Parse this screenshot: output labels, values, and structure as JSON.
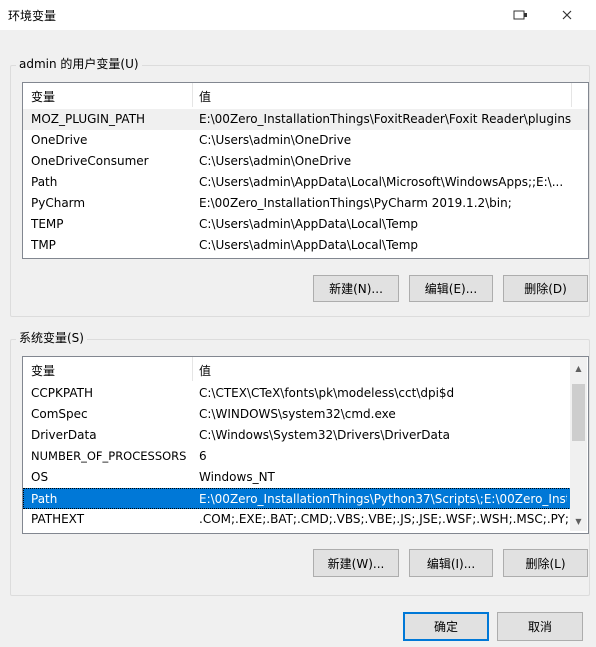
{
  "window": {
    "title": "环境变量",
    "icons": [
      "restore-icon",
      "close-icon"
    ]
  },
  "user_group": {
    "label": "admin 的用户变量(U)",
    "columns": {
      "name": "变量",
      "value": "值"
    },
    "rows": [
      {
        "name": "MOZ_PLUGIN_PATH",
        "value": "E:\\00Zero_InstallationThings\\FoxitReader\\Foxit Reader\\plugins\\"
      },
      {
        "name": "OneDrive",
        "value": "C:\\Users\\admin\\OneDrive"
      },
      {
        "name": "OneDriveConsumer",
        "value": "C:\\Users\\admin\\OneDrive"
      },
      {
        "name": "Path",
        "value": "C:\\Users\\admin\\AppData\\Local\\Microsoft\\WindowsApps;;E:\\..."
      },
      {
        "name": "PyCharm",
        "value": "E:\\00Zero_InstallationThings\\PyCharm 2019.1.2\\bin;"
      },
      {
        "name": "TEMP",
        "value": "C:\\Users\\admin\\AppData\\Local\\Temp"
      },
      {
        "name": "TMP",
        "value": "C:\\Users\\admin\\AppData\\Local\\Temp"
      }
    ],
    "buttons": {
      "new": "新建(N)...",
      "edit": "编辑(E)...",
      "delete": "删除(D)"
    }
  },
  "system_group": {
    "label": "系统变量(S)",
    "columns": {
      "name": "变量",
      "value": "值"
    },
    "rows": [
      {
        "name": "CCPKPATH",
        "value": "C:\\CTEX\\CTeX\\fonts\\pk\\modeless\\cct\\dpi$d"
      },
      {
        "name": "ComSpec",
        "value": "C:\\WINDOWS\\system32\\cmd.exe"
      },
      {
        "name": "DriverData",
        "value": "C:\\Windows\\System32\\Drivers\\DriverData"
      },
      {
        "name": "NUMBER_OF_PROCESSORS",
        "value": "6"
      },
      {
        "name": "OS",
        "value": "Windows_NT"
      },
      {
        "name": "Path",
        "value": "E:\\00Zero_InstallationThings\\Python37\\Scripts\\;E:\\00Zero_Inst..."
      },
      {
        "name": "PATHEXT",
        "value": ".COM;.EXE;.BAT;.CMD;.VBS;.VBE;.JS;.JSE;.WSF;.WSH;.MSC;.PY;.P..."
      }
    ],
    "buttons": {
      "new": "新建(W)...",
      "edit": "编辑(I)...",
      "delete": "删除(L)"
    }
  },
  "footer": {
    "ok": "确定",
    "cancel": "取消"
  }
}
